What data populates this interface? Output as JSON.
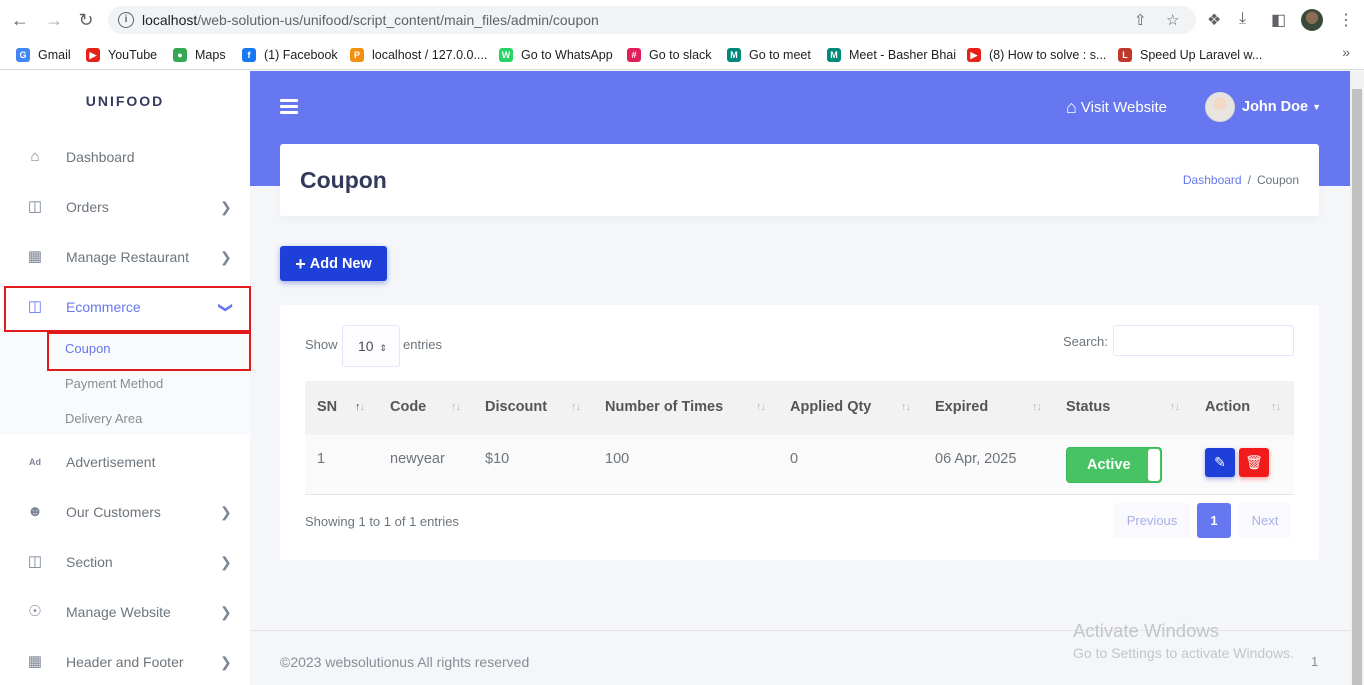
{
  "browser": {
    "url_host": "localhost",
    "url_path": "/web-solution-us/unifood/script_content/main_files/admin/coupon",
    "bookmarks": [
      {
        "label": "Gmail",
        "icon": "gmail-icon",
        "color": "#4285f4"
      },
      {
        "label": "YouTube",
        "icon": "youtube-icon",
        "color": "#e62117"
      },
      {
        "label": "Maps",
        "icon": "maps-icon",
        "color": "#34a853"
      },
      {
        "label": "(1) Facebook",
        "icon": "facebook-icon",
        "color": "#1877f2"
      },
      {
        "label": "localhost / 127.0.0....",
        "icon": "phpmyadmin-icon",
        "color": "#f29111"
      },
      {
        "label": "Go to WhatsApp",
        "icon": "whatsapp-icon",
        "color": "#25d366"
      },
      {
        "label": "Go to slack",
        "icon": "slack-icon",
        "color": "#e01e5a"
      },
      {
        "label": "Go to meet",
        "icon": "meet-icon",
        "color": "#00897b"
      },
      {
        "label": "Meet - Basher Bhai",
        "icon": "meet-icon",
        "color": "#00897b"
      },
      {
        "label": "(8) How to solve : s...",
        "icon": "youtube-icon",
        "color": "#e62117"
      },
      {
        "label": "Speed Up Laravel w...",
        "icon": "laravel-icon",
        "color": "#c0392b"
      }
    ]
  },
  "sidebar": {
    "brand": "UNIFOOD",
    "items": [
      {
        "label": "Dashboard",
        "icon": "home-icon"
      },
      {
        "label": "Orders",
        "icon": "cart-icon"
      },
      {
        "label": "Manage Restaurant",
        "icon": "grid-icon"
      },
      {
        "label": "Ecommerce",
        "icon": "cart-icon"
      },
      {
        "label": "Advertisement",
        "icon": "ad-icon"
      },
      {
        "label": "Our Customers",
        "icon": "users-icon"
      },
      {
        "label": "Section",
        "icon": "cart-icon"
      },
      {
        "label": "Manage Website",
        "icon": "globe-icon"
      },
      {
        "label": "Header and Footer",
        "icon": "grid-icon"
      }
    ],
    "submenu": [
      "Coupon",
      "Payment Method",
      "Delivery Area"
    ]
  },
  "topbar": {
    "visit_label": "Visit Website",
    "user_name": "John Doe"
  },
  "page": {
    "title": "Coupon",
    "breadcrumb_link": "Dashboard",
    "breadcrumb_sep": "/",
    "breadcrumb_current": "Coupon",
    "add_label": "Add New"
  },
  "table": {
    "show_label": "Show",
    "entries_value": "10",
    "entries_label": "entries",
    "search_label": "Search:",
    "columns": [
      "SN",
      "Code",
      "Discount",
      "Number of Times",
      "Applied Qty",
      "Expired",
      "Status",
      "Action"
    ],
    "rows": [
      {
        "sn": "1",
        "code": "newyear",
        "discount": "$10",
        "times": "100",
        "applied": "0",
        "expired": "06 Apr, 2025",
        "status": "Active"
      }
    ],
    "info": "Showing 1 to 1 of 1 entries",
    "prev_label": "Previous",
    "page_number": "1",
    "next_label": "Next"
  },
  "footer": {
    "copyright": "©2023 websolutionus All rights reserved",
    "version": "1"
  },
  "watermark": {
    "line1": "Activate Windows",
    "line2": "Go to Settings to activate Windows."
  },
  "colors": {
    "primary": "#6777ef",
    "add_button": "#1e3fd8",
    "active_toggle": "#47c363",
    "delete_button": "#f21b1b",
    "highlight_box": "#e01b1b"
  }
}
